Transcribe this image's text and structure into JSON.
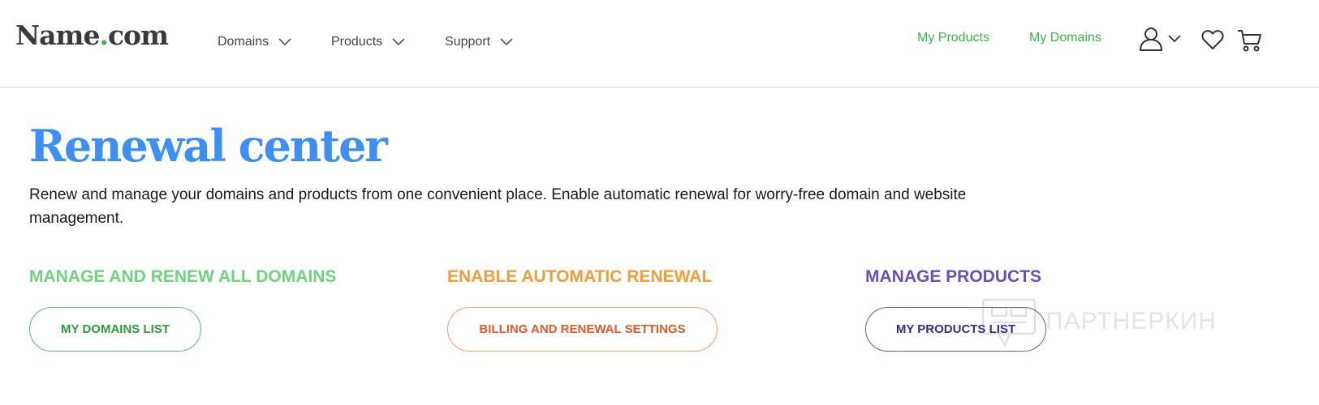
{
  "header": {
    "logo": {
      "name": "Name",
      "dot": ".",
      "tld": "com",
      "dot_color": "#3ab54a"
    },
    "nav": [
      {
        "label": "Domains",
        "icon": "chevron-down-icon"
      },
      {
        "label": "Products",
        "icon": "chevron-down-icon"
      },
      {
        "label": "Support",
        "icon": "chevron-down-icon"
      }
    ],
    "links": {
      "my_products": "My Products",
      "my_domains": "My Domains"
    },
    "icons": [
      "user-icon",
      "chevron-down-icon",
      "heart-icon",
      "cart-icon"
    ],
    "link_color": "#3ab54a"
  },
  "main": {
    "title": "Renewal center",
    "title_color": "#3d8ff5",
    "intro": "Renew and manage your domains and products from one convenient place. Enable automatic renewal for worry-free domain and website management.",
    "sections": [
      {
        "heading": "MANAGE AND RENEW ALL DOMAINS",
        "button": "MY DOMAINS LIST",
        "color": "#6fd37e"
      },
      {
        "heading": "ENABLE AUTOMATIC RENEWAL",
        "button": "BILLING AND RENEWAL SETTINGS",
        "color": "#f49b3b"
      },
      {
        "heading": "MANAGE PRODUCTS",
        "button": "MY PRODUCTS LIST",
        "color": "#6a4fbb"
      }
    ]
  },
  "watermark": {
    "text": "ПАРТНЕРКИН"
  }
}
